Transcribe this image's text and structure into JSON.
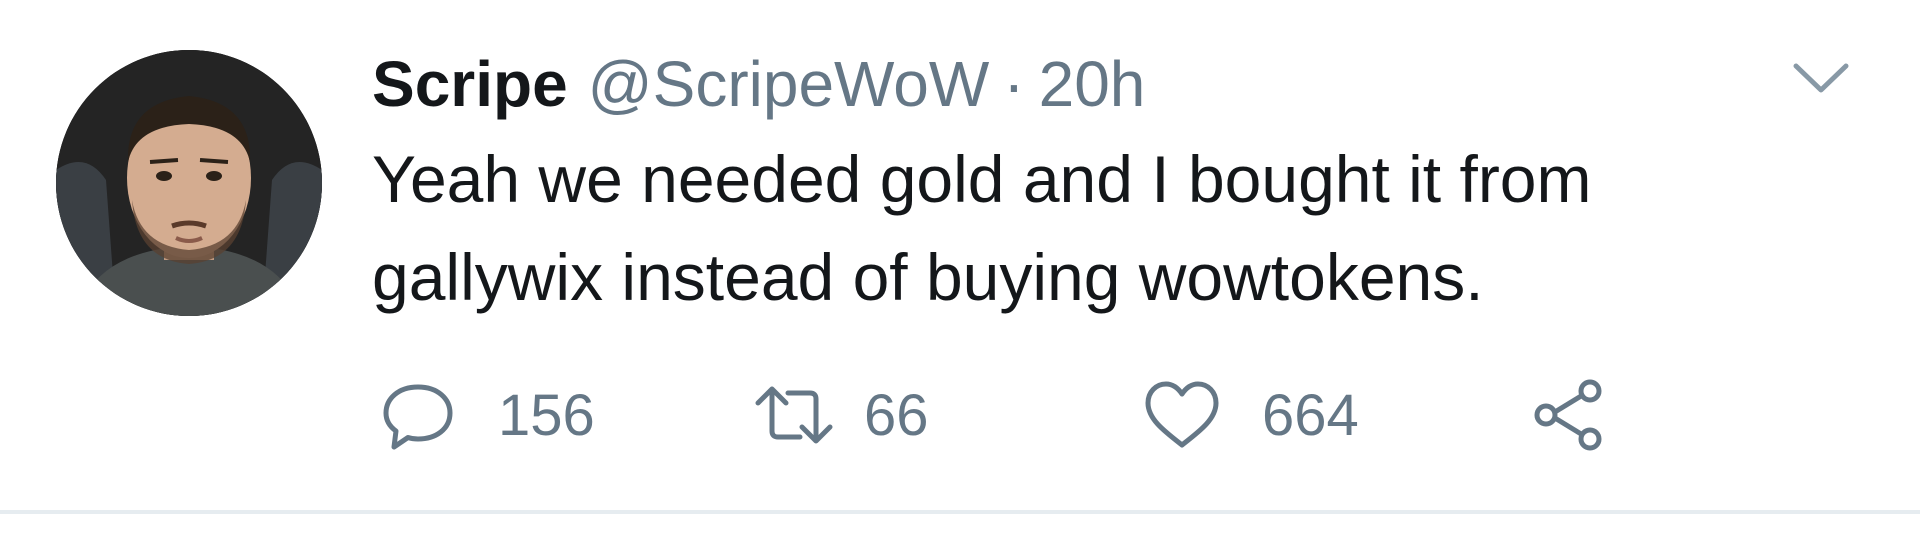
{
  "tweet": {
    "author": {
      "display_name": "Scripe",
      "handle": "@ScripeWoW",
      "separator": "·",
      "time_ago": "20h"
    },
    "text": "Yeah we needed gold and I bought it from gallywix instead of buying wowtokens.",
    "actions": {
      "reply_count": "156",
      "retweet_count": "66",
      "like_count": "664"
    },
    "icons": {
      "avatar": "user-avatar",
      "menu": "chevron-down-icon",
      "reply": "reply-icon",
      "retweet": "retweet-icon",
      "like": "heart-icon",
      "share": "share-icon"
    },
    "colors": {
      "primary_text": "#14171a",
      "secondary_text": "#657786",
      "divider": "#e6ecf0"
    }
  }
}
